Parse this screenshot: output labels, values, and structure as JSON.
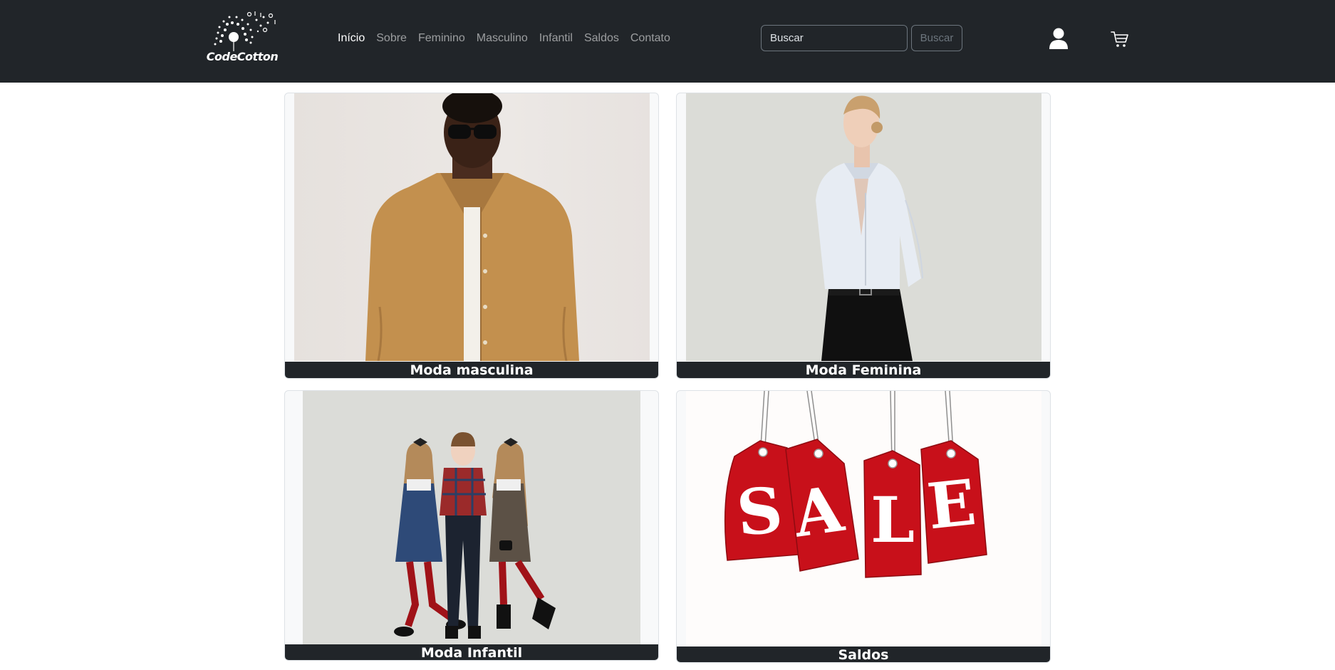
{
  "brand": {
    "logo_text": "CodeCotton"
  },
  "nav": {
    "items": [
      {
        "label": "Início",
        "active": true
      },
      {
        "label": "Sobre",
        "active": false
      },
      {
        "label": "Feminino",
        "active": false
      },
      {
        "label": "Masculino",
        "active": false
      },
      {
        "label": "Infantil",
        "active": false
      },
      {
        "label": "Saldos",
        "active": false
      },
      {
        "label": "Contato",
        "active": false
      }
    ]
  },
  "search": {
    "placeholder": "Buscar",
    "button_label": "Buscar"
  },
  "icons": {
    "user": "user-icon",
    "cart": "cart-icon"
  },
  "categories": [
    {
      "title": "Moda masculina"
    },
    {
      "title": "Moda Feminina"
    },
    {
      "title": "Moda Infantil"
    },
    {
      "title": "Saldos",
      "sale_word": "SALE"
    }
  ],
  "colors": {
    "navbar": "#212529",
    "caption_bg": "#212529",
    "sale_red": "#c8101a"
  }
}
